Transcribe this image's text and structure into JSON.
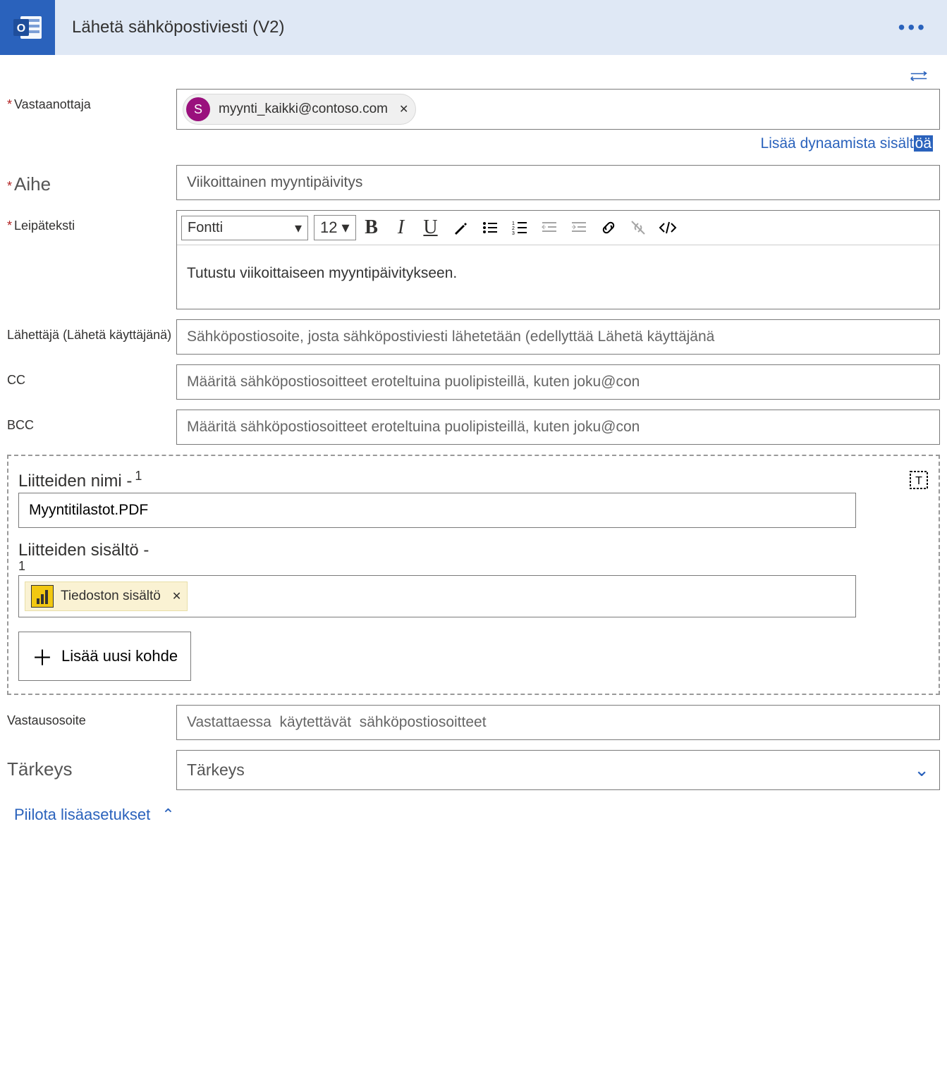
{
  "header": {
    "title": "Lähetä sähköpostiviesti (V2)"
  },
  "recipient": {
    "label": "Vastaanottaja",
    "chip_avatar": "S",
    "chip_email": "myynti_kaikki@contoso.com"
  },
  "dynamic_link": {
    "prefix": "Lisää dynaamista sisält",
    "highlight": "öä"
  },
  "subject": {
    "label": "Aihe",
    "value": "Viikoittainen myyntipäivitys"
  },
  "body": {
    "label": "Leipäteksti",
    "font_label": "Fontti",
    "font_size": "12",
    "content": "Tutustu viikoittaiseen myyntipäivitykseen."
  },
  "from": {
    "label": "Lähettäjä (Lähetä käyttäjänä)",
    "placeholder": "Sähköpostiosoite, josta sähköpostiviesti lähetetään (edellyttää Lähetä käyttäjänä"
  },
  "cc": {
    "label": "CC",
    "placeholder": "Määritä sähköpostiosoitteet eroteltuina puolipisteillä, kuten joku@con"
  },
  "bcc": {
    "label": "BCC",
    "placeholder": "Määritä sähköpostiosoitteet eroteltuina puolipisteillä, kuten joku@con"
  },
  "attachments": {
    "name_label": "Liitteiden nimi -",
    "name_index": "1",
    "name_value": "Myyntitilastot.PDF",
    "content_label": "Liitteiden sisältö   -",
    "content_index": "1",
    "token_label": "Tiedoston sisältö",
    "add_button": "Lisää uusi kohde"
  },
  "reply_to": {
    "label": "Vastausosoite",
    "placeholder": "Vastattaessa  käytettävät  sähköpostiosoitteet"
  },
  "importance": {
    "label": "Tärkeys",
    "value": "Tärkeys"
  },
  "hide_advanced": "Piilota lisäasetukset"
}
